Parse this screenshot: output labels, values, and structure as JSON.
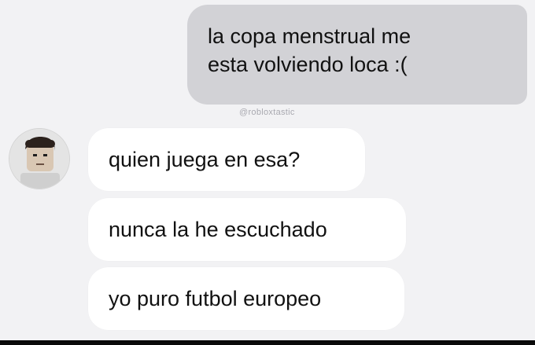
{
  "chat": {
    "sent_message": {
      "lines": [
        "la copa menstrual me",
        "esta volviendo loca :("
      ]
    },
    "watermark": "@robloxtastic",
    "received_messages": [
      "quien juega en esa?",
      "nunca la he escuchado",
      "yo puro futbol europeo"
    ],
    "avatar_icon": "roblox-avatar-icon"
  },
  "colors": {
    "background": "#f2f2f4",
    "sent_bubble": "#d2d2d6",
    "received_bubble": "#ffffff",
    "text": "#111111"
  }
}
